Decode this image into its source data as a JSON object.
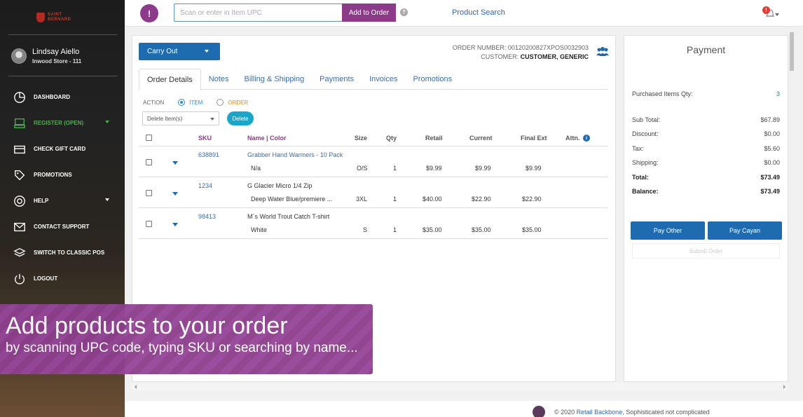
{
  "brand": {
    "line1": "SAINT",
    "line2": "BERNARD"
  },
  "user": {
    "name": "Lindsay Aiello",
    "store": "Inwood Store - 111"
  },
  "nav": [
    {
      "label": "DASHBOARD",
      "icon": "pie-chart-icon"
    },
    {
      "label": "REGISTER (OPEN)",
      "icon": "register-icon",
      "active": true
    },
    {
      "label": "CHECK GIFT CARD",
      "icon": "card-icon"
    },
    {
      "label": "PROMOTIONS",
      "icon": "tag-icon"
    },
    {
      "label": "HELP",
      "icon": "lifebuoy-icon"
    },
    {
      "label": "CONTACT SUPPORT",
      "icon": "envelope-icon"
    },
    {
      "label": "SWITCH TO CLASSIC POS",
      "icon": "layers-icon"
    },
    {
      "label": "LOGOUT",
      "icon": "power-icon"
    }
  ],
  "topbar": {
    "menu_label": "!",
    "scan_placeholder": "Scan or enter in Item UPC",
    "add_to_order": "Add to Order",
    "help": "?",
    "product_search": "Product Search",
    "notification_count": "!"
  },
  "order": {
    "service_type": "Carry Out",
    "number_label": "ORDER NUMBER:",
    "number": "00120200827XPOS0032903",
    "customer_label": "CUSTOMER:",
    "customer": "CUSTOMER, GENERIC"
  },
  "tabs": [
    "Order Details",
    "Notes",
    "Billing & Shipping",
    "Payments",
    "Invoices",
    "Promotions"
  ],
  "action": {
    "label": "ACTION",
    "item": "ITEM",
    "order": "ORDER",
    "select_value": "Delete Item(s)",
    "delete": "Delete"
  },
  "table": {
    "headers": {
      "sku": "SKU",
      "name": "Name | Color",
      "size": "Size",
      "qty": "Qty",
      "retail": "Retail",
      "current": "Current",
      "final": "Final Ext",
      "attn": "Attn."
    },
    "rows": [
      {
        "sku": "638891",
        "name": "Grabber Hand Warmers - 10 Pack",
        "color": "N/a",
        "size": "O/S",
        "qty": "1",
        "retail": "$9.99",
        "current": "$9.99",
        "final": "$9.99"
      },
      {
        "sku": "1234",
        "name": "G Glacier Micro 1/4 Zip",
        "color": "Deep Water Blue/premiere ...",
        "size": "3XL",
        "qty": "1",
        "retail": "$40.00",
        "current": "$22.90",
        "final": "$22.90"
      },
      {
        "sku": "98413",
        "name": "M´s World Trout Catch T-shirt",
        "color": "White",
        "size": "S",
        "qty": "1",
        "retail": "$35.00",
        "current": "$35.00",
        "final": "$35.00"
      }
    ]
  },
  "payment": {
    "title": "Payment",
    "qty_label": "Purchased Items Qty:",
    "qty": "3",
    "subtotal_label": "Sub Total:",
    "subtotal": "$67.89",
    "discount_label": "Discount:",
    "discount": "$0.00",
    "tax_label": "Tax:",
    "tax": "$5.60",
    "shipping_label": "Shipping:",
    "shipping": "$0.00",
    "total_label": "Total:",
    "total": "$73.49",
    "balance_label": "Balance:",
    "balance": "$73.49",
    "pay_other": "Pay Other",
    "pay_cayan": "Pay Cayan",
    "submit": "Submit Order"
  },
  "footer": {
    "prefix": "© 2020 ",
    "link": "Retail Backbone",
    "suffix": ", Sophisticated not complicated"
  },
  "overlay": {
    "title": "Add products to your order",
    "subtitle": "by scanning UPC code, typing SKU or searching by name..."
  },
  "colors": {
    "accent": "#8e3a8a",
    "primary": "#1f6bb0",
    "active_nav": "#4caf50"
  }
}
